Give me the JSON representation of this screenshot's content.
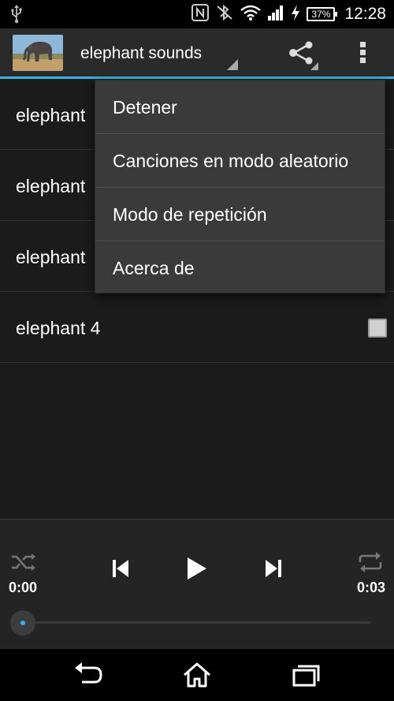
{
  "status_bar": {
    "icons": [
      "usb-icon",
      "nfc-icon",
      "bluetooth-icon",
      "wifi-icon",
      "signal-icon",
      "charging-icon"
    ],
    "battery": "37%",
    "time": "12:28"
  },
  "action_bar": {
    "title": "elephant sounds",
    "icons": [
      "app-thumbnail",
      "share-icon",
      "overflow-menu-icon"
    ],
    "accent_color": "#33b5e5"
  },
  "playlist": {
    "items": [
      {
        "label": "elephant"
      },
      {
        "label": "elephant"
      },
      {
        "label": "elephant"
      },
      {
        "label": "elephant 4"
      }
    ]
  },
  "overflow_menu": {
    "items": [
      {
        "label": "Detener"
      },
      {
        "label": "Canciones en modo aleatorio"
      },
      {
        "label": "Modo de repetición"
      },
      {
        "label": "Acerca de"
      }
    ]
  },
  "player": {
    "elapsed": "0:00",
    "duration": "0:03",
    "progress": 0,
    "icons": [
      "shuffle-icon",
      "previous-icon",
      "play-icon",
      "next-icon",
      "repeat-icon"
    ]
  },
  "nav_bar": {
    "icons": [
      "back-icon",
      "home-icon",
      "recents-icon"
    ]
  }
}
